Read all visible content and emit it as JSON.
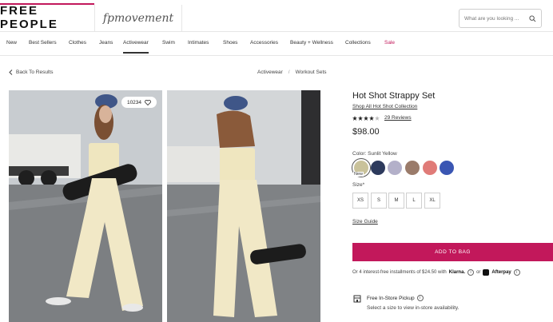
{
  "header": {
    "brand_primary": "FREE PEOPLE",
    "brand_secondary": "fpmovement",
    "search_placeholder": "What are you looking ..."
  },
  "nav": {
    "items": [
      "New",
      "Best Sellers",
      "Clothes",
      "Jeans",
      "Activewear",
      "Swim",
      "Intimates",
      "Shoes",
      "Accessories",
      "Beauty + Wellness",
      "Collections",
      "Sale"
    ],
    "active": "Activewear"
  },
  "breadcrumb": {
    "back_label": "Back To Results",
    "crumbs": [
      "Activewear",
      "Workout Sets"
    ]
  },
  "gallery": {
    "wishlist_count": "10234"
  },
  "product": {
    "title": "Hot Shot Strappy Set",
    "shop_all": "Shop All Hot Shot Collection",
    "rating": 4.5,
    "reviews": "29 Reviews",
    "price": "$98.00",
    "color_label": "Color: Sunlit Yellow",
    "new_tag": "New",
    "colors": [
      {
        "name": "sunlit-yellow",
        "hex": "#c9c29a"
      },
      {
        "name": "navy",
        "hex": "#2d3a5c"
      },
      {
        "name": "lavender",
        "hex": "#b3b0c9"
      },
      {
        "name": "mocha",
        "hex": "#9a7b6a"
      },
      {
        "name": "coral",
        "hex": "#e07b78"
      },
      {
        "name": "royal-blue",
        "hex": "#3a56b3"
      }
    ],
    "size_label": "Size*",
    "sizes": [
      "XS",
      "S",
      "M",
      "L",
      "XL"
    ],
    "size_guide": "Size Guide",
    "add_to_bag": "ADD TO BAG",
    "installments_text": "Or 4 interest-free installments of $24.50 with",
    "klarna": "Klarna.",
    "or_text": "or",
    "afterpay": "Afterpay",
    "pickup_title": "Free In-Store Pickup",
    "pickup_sub": "Select a size to view in-store availability."
  },
  "colors": {
    "accent": "#c2185b"
  }
}
